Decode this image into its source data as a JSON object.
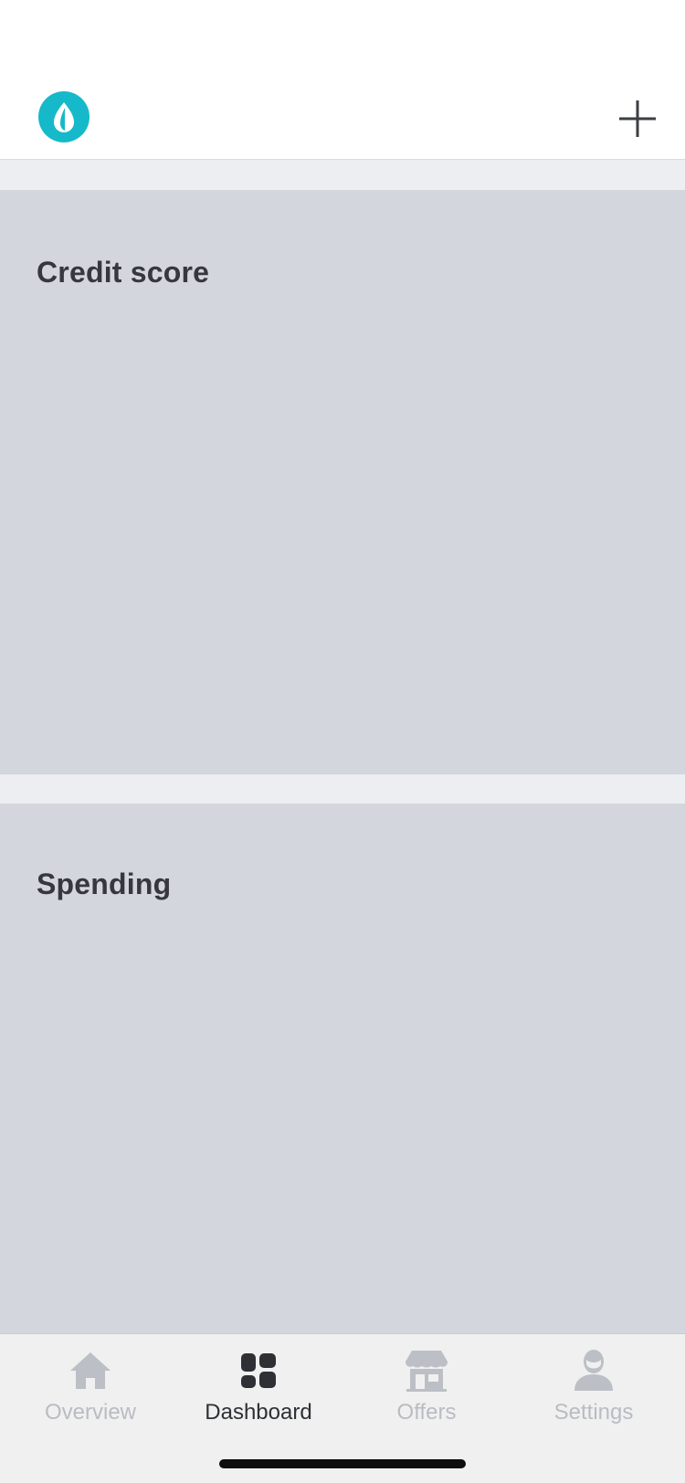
{
  "header": {
    "logo_icon": "mint-leaf-logo",
    "add_icon": "plus-icon"
  },
  "cards": {
    "credit_score": {
      "title": "Credit score"
    },
    "spending": {
      "title": "Spending"
    }
  },
  "tabbar": {
    "active": "Dashboard",
    "tabs": [
      {
        "label": "Overview",
        "icon": "house-icon"
      },
      {
        "label": "Dashboard",
        "icon": "grid-icon"
      },
      {
        "label": "Offers",
        "icon": "storefront-icon"
      },
      {
        "label": "Settings",
        "icon": "person-icon"
      }
    ]
  },
  "colors": {
    "brand": "#16b9c9",
    "card_placeholder": "#d3d6dc",
    "page_background": "#eceef2",
    "tab_active": "#2e3035",
    "tab_inactive": "#b9bcc2"
  }
}
